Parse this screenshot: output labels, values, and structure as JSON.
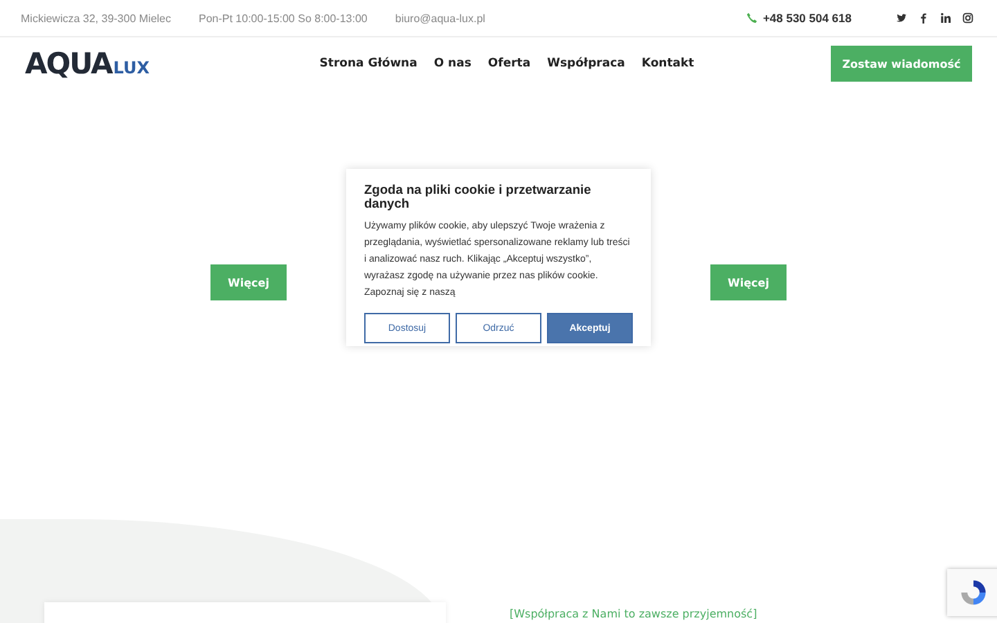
{
  "topbar": {
    "address": "Mickiewicza 32, 39-300 Mielec",
    "hours": "Pon-Pt 10:00-15:00 So 8:00-13:00",
    "email": "biuro@aqua-lux.pl",
    "phone": "+48 530 504 618"
  },
  "header": {
    "logo_main": "AQUA",
    "logo_sub": "LUX",
    "nav": [
      {
        "label": "Strona Główna"
      },
      {
        "label": "O nas"
      },
      {
        "label": "Oferta"
      },
      {
        "label": "Współpraca"
      },
      {
        "label": "Kontakt"
      }
    ],
    "cta": "Zostaw wiadomość"
  },
  "hero": {
    "buttons": [
      "Więcej",
      "Więcej"
    ]
  },
  "cookie_dialog": {
    "title": "Zgoda na pliki cookie i przetwarzanie danych",
    "text": "Używamy plików cookie, aby ulepszyć Twoje wrażenia z przeglądania, wyświetlać spersonalizowane reklamy lub treści i analizować nasz ruch. Klikając „Akceptuj wszystko”, wyrażasz zgodę na używanie przez nas plików cookie. Zapoznaj się z naszą",
    "buttons": [
      {
        "label": "Dostosuj",
        "kind": "outline"
      },
      {
        "label": "Odrzuć",
        "kind": "outline"
      },
      {
        "label": "Akceptuj",
        "kind": "primary"
      }
    ]
  },
  "section": {
    "tagline": "[Współpraca z Nami to zawsze przyjemność]"
  }
}
